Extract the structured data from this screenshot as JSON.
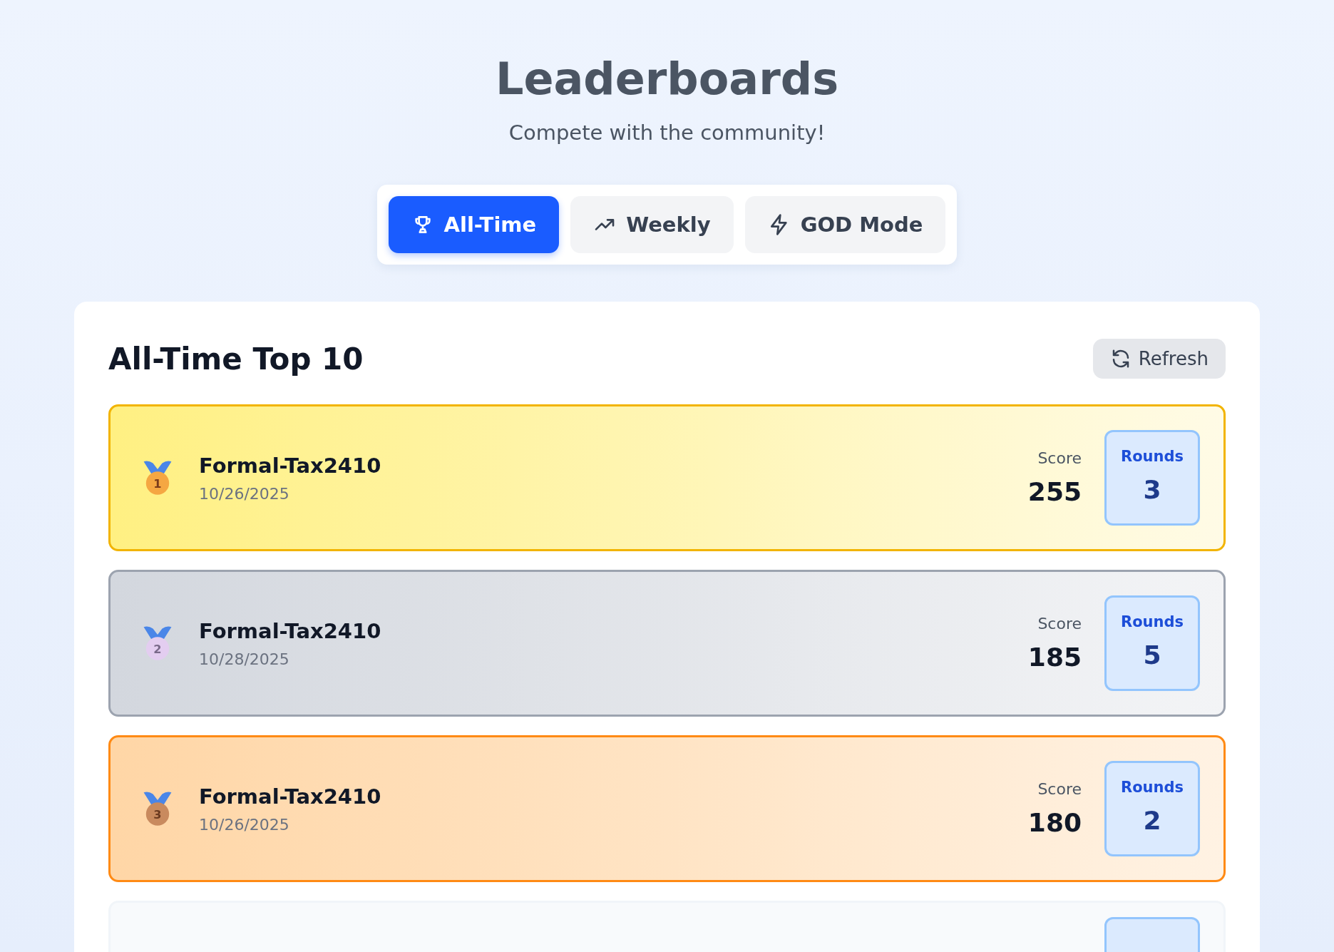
{
  "header": {
    "title": "Leaderboards",
    "subtitle": "Compete with the community!"
  },
  "tabs": [
    {
      "label": "All-Time",
      "kind": "trophy",
      "selected": true
    },
    {
      "label": "Weekly",
      "kind": "trend",
      "selected": false
    },
    {
      "label": "GOD Mode",
      "kind": "bolt",
      "selected": false
    }
  ],
  "board": {
    "title": "All-Time Top 10",
    "refresh": "Refresh",
    "rows": [
      {
        "kind": "gold",
        "rank": "1",
        "name": "Formal-Tax2410",
        "date": "10/26/2025",
        "score_label": "Score",
        "score": "255",
        "rounds_label": "Rounds",
        "rounds": "3"
      },
      {
        "kind": "silver",
        "rank": "2",
        "name": "Formal-Tax2410",
        "date": "10/28/2025",
        "score_label": "Score",
        "score": "185",
        "rounds_label": "Rounds",
        "rounds": "5"
      },
      {
        "kind": "bronze",
        "rank": "3",
        "name": "Formal-Tax2410",
        "date": "10/26/2025",
        "score_label": "Score",
        "score": "180",
        "rounds_label": "Rounds",
        "rounds": "2"
      },
      {
        "kind": "plain"
      }
    ]
  }
}
